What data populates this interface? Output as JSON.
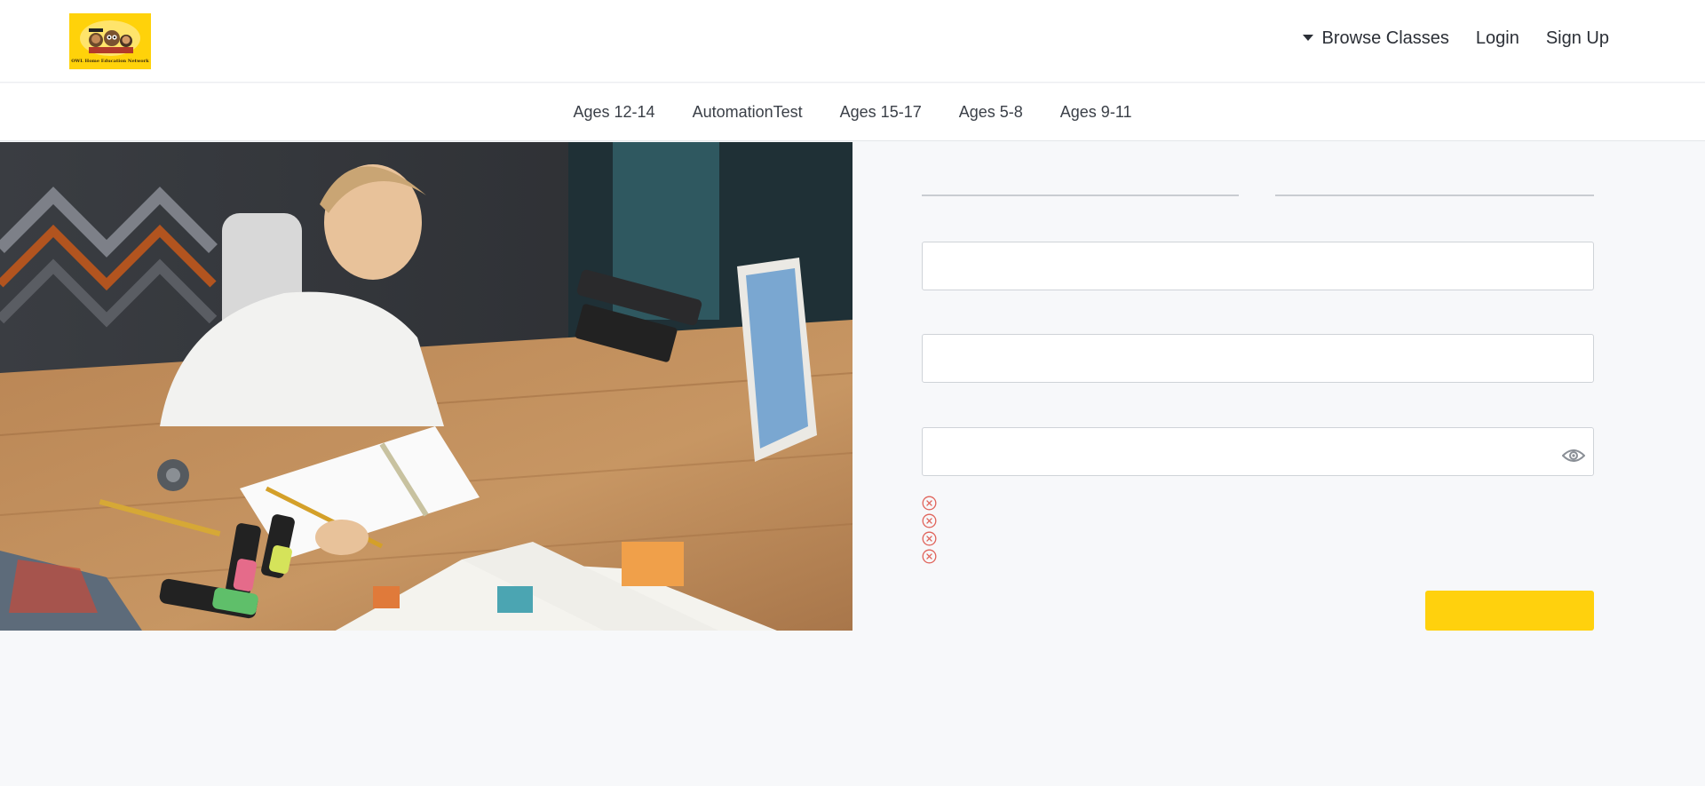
{
  "header": {
    "logo_text": "OWL Home Education Network",
    "nav": {
      "browse": "Browse Classes",
      "login": "Login",
      "signup": "Sign Up"
    }
  },
  "categories": [
    "Ages 12-14",
    "AutomationTest",
    "Ages 15-17",
    "Ages 5-8",
    "Ages 9-11"
  ],
  "form": {
    "first_tab": "",
    "second_tab": "",
    "field1_value": "",
    "field2_value": "",
    "password_value": "",
    "rules": [
      "",
      "",
      "",
      ""
    ],
    "submit_label": ""
  },
  "colors": {
    "accent": "#ffd10d",
    "error": "#d9534f",
    "background": "#f7f8fa"
  },
  "icons": {
    "browse": "caret-down-icon",
    "password": "eye-icon",
    "rule_status": "x-circle-icon"
  }
}
